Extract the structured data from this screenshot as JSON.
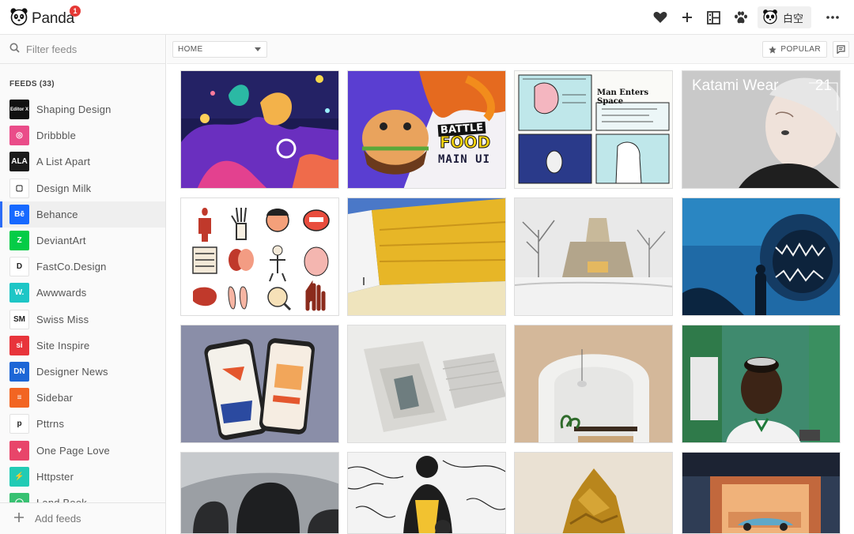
{
  "app": {
    "name": "Panda",
    "notification_count": "1"
  },
  "topbar": {
    "icons": [
      "heart-icon",
      "plus-icon",
      "layout-icon",
      "paw-icon"
    ],
    "user_name": "白空",
    "more_icon": "more-icon"
  },
  "sidebar": {
    "filter_placeholder": "Filter feeds",
    "feeds_title": "FEEDS (33)",
    "items": [
      {
        "label": "Shaping Design",
        "bg": "#111111",
        "glyph": "Editor X"
      },
      {
        "label": "Dribbble",
        "bg": "#ea4c89",
        "glyph": "◎"
      },
      {
        "label": "A List Apart",
        "bg": "#1b1b1b",
        "glyph": "ALA"
      },
      {
        "label": "Design Milk",
        "bg": "#ffffff",
        "glyph": "▢"
      },
      {
        "label": "Behance",
        "bg": "#1769ff",
        "glyph": "Bē"
      },
      {
        "label": "DeviantArt",
        "bg": "#05cc47",
        "glyph": "Z"
      },
      {
        "label": "FastCo.Design",
        "bg": "#ffffff",
        "glyph": "D"
      },
      {
        "label": "Awwwards",
        "bg": "#1ec6c6",
        "glyph": "W."
      },
      {
        "label": "Swiss Miss",
        "bg": "#ffffff",
        "glyph": "SM"
      },
      {
        "label": "Site Inspire",
        "bg": "#e8343b",
        "glyph": "si"
      },
      {
        "label": "Designer News",
        "bg": "#1d66d6",
        "glyph": "DN"
      },
      {
        "label": "Sidebar",
        "bg": "#f26522",
        "glyph": "≡"
      },
      {
        "label": "Pttrns",
        "bg": "#ffffff",
        "glyph": "p"
      },
      {
        "label": "One Page Love",
        "bg": "#e8456a",
        "glyph": "♥"
      },
      {
        "label": "Httpster",
        "bg": "#21cbb5",
        "glyph": "⚡"
      },
      {
        "label": "Land Book",
        "bg": "#38c172",
        "glyph": "◯"
      }
    ],
    "add_feeds": "Add feeds"
  },
  "toolbar": {
    "home_select": "HOME",
    "popular_label": "POPULAR"
  },
  "cards": {
    "battle": "BATTLE",
    "food": "FOOD",
    "main_ui": "MAIN UI",
    "comic_title": "Man Enters Space",
    "katami": "Katami Wear",
    "katami_num": "21"
  }
}
